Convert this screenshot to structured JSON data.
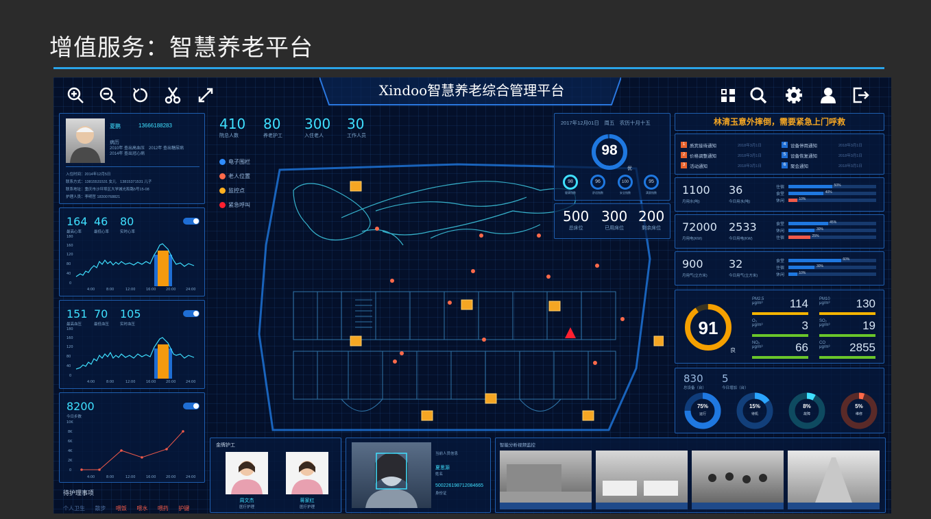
{
  "slide": {
    "title": "增值服务：智慧养老平台"
  },
  "header": {
    "title": "Xindoo智慧养老综合管理平台"
  },
  "toolbar": {
    "left_icons": [
      "zoom-in-icon",
      "zoom-out-icon",
      "refresh-icon",
      "scissors-icon",
      "fullscreen-icon"
    ],
    "right_icons": [
      "grid-icon",
      "search-icon",
      "gear-icon",
      "user-icon",
      "logout-icon"
    ]
  },
  "resident": {
    "name": "夏鹏",
    "phone": "13666188283",
    "history_label": "病历",
    "history_lines": [
      "2010年 查出高血压　2012年 查出糖尿病",
      "2014年 查出冠心病"
    ],
    "checkin": "入住时间：2014年12月5日",
    "contact": "联系方式：13815531531 女儿　13815371531 儿子",
    "address": "联系地址：重庆市沙坪坝区大学城光和路5号15-08",
    "nurse": "护理人员：李明哲 18300768821"
  },
  "heart": {
    "values": [
      "164",
      "46",
      "80"
    ],
    "labels": [
      "最高心率",
      "最低心率",
      "实时心率"
    ],
    "yticks": [
      "180",
      "160",
      "140",
      "120",
      "100",
      "80",
      "60",
      "40",
      "20",
      "0"
    ],
    "xticks": [
      "4:00",
      "8:00",
      "12:00",
      "16:00",
      "20:00",
      "24:00"
    ]
  },
  "bp": {
    "values": [
      "151",
      "70",
      "105"
    ],
    "labels": [
      "最高血压",
      "最低血压",
      "实时血压"
    ],
    "yticks": [
      "180",
      "160",
      "140",
      "120",
      "100",
      "80",
      "60",
      "40",
      "20",
      "0"
    ],
    "xticks": [
      "4:00",
      "8:00",
      "12:00",
      "16:00",
      "20:00",
      "24:00"
    ]
  },
  "steps": {
    "value": "8200",
    "label": "今日步数",
    "yticks": [
      "10K",
      "8K",
      "6K",
      "4K",
      "2K",
      "0"
    ],
    "xticks": [
      "4:00",
      "8:00",
      "12:00",
      "16:00",
      "20:00",
      "24:00"
    ]
  },
  "care_tasks": {
    "title": "待护理事项",
    "items": [
      "个人卫生",
      "散步",
      "喂饭",
      "喂水",
      "喂药",
      "护键"
    ]
  },
  "stats": [
    {
      "value": "410",
      "label": "院总人数"
    },
    {
      "value": "80",
      "label": "养老护工"
    },
    {
      "value": "300",
      "label": "入住老人"
    },
    {
      "value": "30",
      "label": "工作人员"
    }
  ],
  "map_legend": [
    {
      "label": "电子围栏",
      "color": "#2f8cff"
    },
    {
      "label": "老人位置",
      "color": "#ff6a4a"
    },
    {
      "label": "监控点",
      "color": "#ffb020"
    },
    {
      "label": "紧急呼叫",
      "color": "#ff2030"
    }
  ],
  "score_panel": {
    "date": "2017年12月01日　周五　农历十月十五",
    "score": "98",
    "grade": "优",
    "mini": [
      "98",
      "96",
      "100",
      "95"
    ],
    "mini_labels": [
      "健康指数",
      "舒适指数",
      "安全指数",
      "满意指数"
    ]
  },
  "beds": [
    {
      "value": "500",
      "label": "总床位"
    },
    {
      "value": "300",
      "label": "已用床位"
    },
    {
      "value": "200",
      "label": "剩余床位"
    }
  ],
  "alert": {
    "text": "林清玉意外摔倒，需要紧急上门呼救"
  },
  "notices": [
    {
      "n": "1",
      "text": "质宾接待通知",
      "date": "2018年3月1日",
      "color": "#e8622c"
    },
    {
      "n": "4",
      "text": "设备停用通知",
      "date": "2018年3月1日",
      "color": "#1f6ed4"
    },
    {
      "n": "2",
      "text": "价格调整通知",
      "date": "2018年3月1日",
      "color": "#e8622c"
    },
    {
      "n": "5",
      "text": "设备恢复通知",
      "date": "2018年3月1日",
      "color": "#1f6ed4"
    },
    {
      "n": "3",
      "text": "活动通知",
      "date": "2018年3月1日",
      "color": "#e8622c"
    },
    {
      "n": "6",
      "text": "聚会通知",
      "date": "2018年3月1日",
      "color": "#1f6ed4"
    }
  ],
  "water": {
    "v1": "1100",
    "l1": "月用水(吨)",
    "v2": "36",
    "l2": "今日用水(吨)",
    "rows": [
      {
        "label": "住宿",
        "pct": 50,
        "text": "50%",
        "color": "#1f78e0"
      },
      {
        "label": "食堂",
        "pct": 40,
        "text": "40%",
        "color": "#1f78e0"
      },
      {
        "label": "休闲",
        "pct": 10,
        "text": "10%",
        "color": "#f05a4a"
      }
    ]
  },
  "power": {
    "v1": "72000",
    "l1": "月用电(KW)",
    "v2": "2533",
    "l2": "今日用电(KW)",
    "rows": [
      {
        "label": "食堂",
        "pct": 45,
        "text": "45%",
        "color": "#1f78e0"
      },
      {
        "label": "休闲",
        "pct": 30,
        "text": "30%",
        "color": "#1f78e0"
      },
      {
        "label": "住宿",
        "pct": 25,
        "text": "25%",
        "color": "#f05a4a"
      }
    ]
  },
  "gas": {
    "v1": "900",
    "l1": "月用气(立方米)",
    "v2": "32",
    "l2": "今日用气(立方米)",
    "rows": [
      {
        "label": "食堂",
        "pct": 60,
        "text": "60%",
        "color": "#1f78e0"
      },
      {
        "label": "住宿",
        "pct": 30,
        "text": "30%",
        "color": "#1f78e0"
      },
      {
        "label": "休闲",
        "pct": 10,
        "text": "10%",
        "color": "#1f78e0"
      }
    ]
  },
  "air": {
    "aqi": "91",
    "grade": "良",
    "items": [
      {
        "name": "PM2.5",
        "unit": "μg/m³",
        "value": "114",
        "color": "#f5b400"
      },
      {
        "name": "PM10",
        "unit": "μg/m³",
        "value": "130",
        "color": "#f5b400"
      },
      {
        "name": "O₃",
        "unit": "μg/m³",
        "value": "3",
        "color": "#6ac62a"
      },
      {
        "name": "SO₂",
        "unit": "μg/m³",
        "value": "19",
        "color": "#6ac62a"
      },
      {
        "name": "NO₂",
        "unit": "μg/m³",
        "value": "66",
        "color": "#6ac62a"
      },
      {
        "name": "CO",
        "unit": "μg/m³",
        "value": "2855",
        "color": "#6ac62a"
      }
    ]
  },
  "devices": {
    "total": "830",
    "total_label": "总设备（台）",
    "today": "5",
    "today_label": "今日增加（台）",
    "donuts": [
      {
        "pct": "75%",
        "label": "运行",
        "color": "#1f78e0",
        "bg": "#0f3c7a"
      },
      {
        "pct": "15%",
        "label": "待机",
        "color": "#2aa4ff",
        "bg": "#123f7a"
      },
      {
        "pct": "8%",
        "label": "故障",
        "color": "#3fe0ff",
        "bg": "#0e4a60"
      },
      {
        "pct": "5%",
        "label": "维修",
        "color": "#ff6a4a",
        "bg": "#5a2a28"
      }
    ]
  },
  "gold_nurses": {
    "title": "金牌护工",
    "nurses": [
      {
        "name": "周文杰",
        "role": "医疗护理"
      },
      {
        "name": "蒋家红",
        "role": "医疗护理"
      }
    ]
  },
  "face": {
    "title": "当前人员信息",
    "name": "夏思源",
    "name_label": "姓名",
    "id": "500226198712084665",
    "id_label": "身份证"
  },
  "video": {
    "title": "智能分析视频监控"
  }
}
